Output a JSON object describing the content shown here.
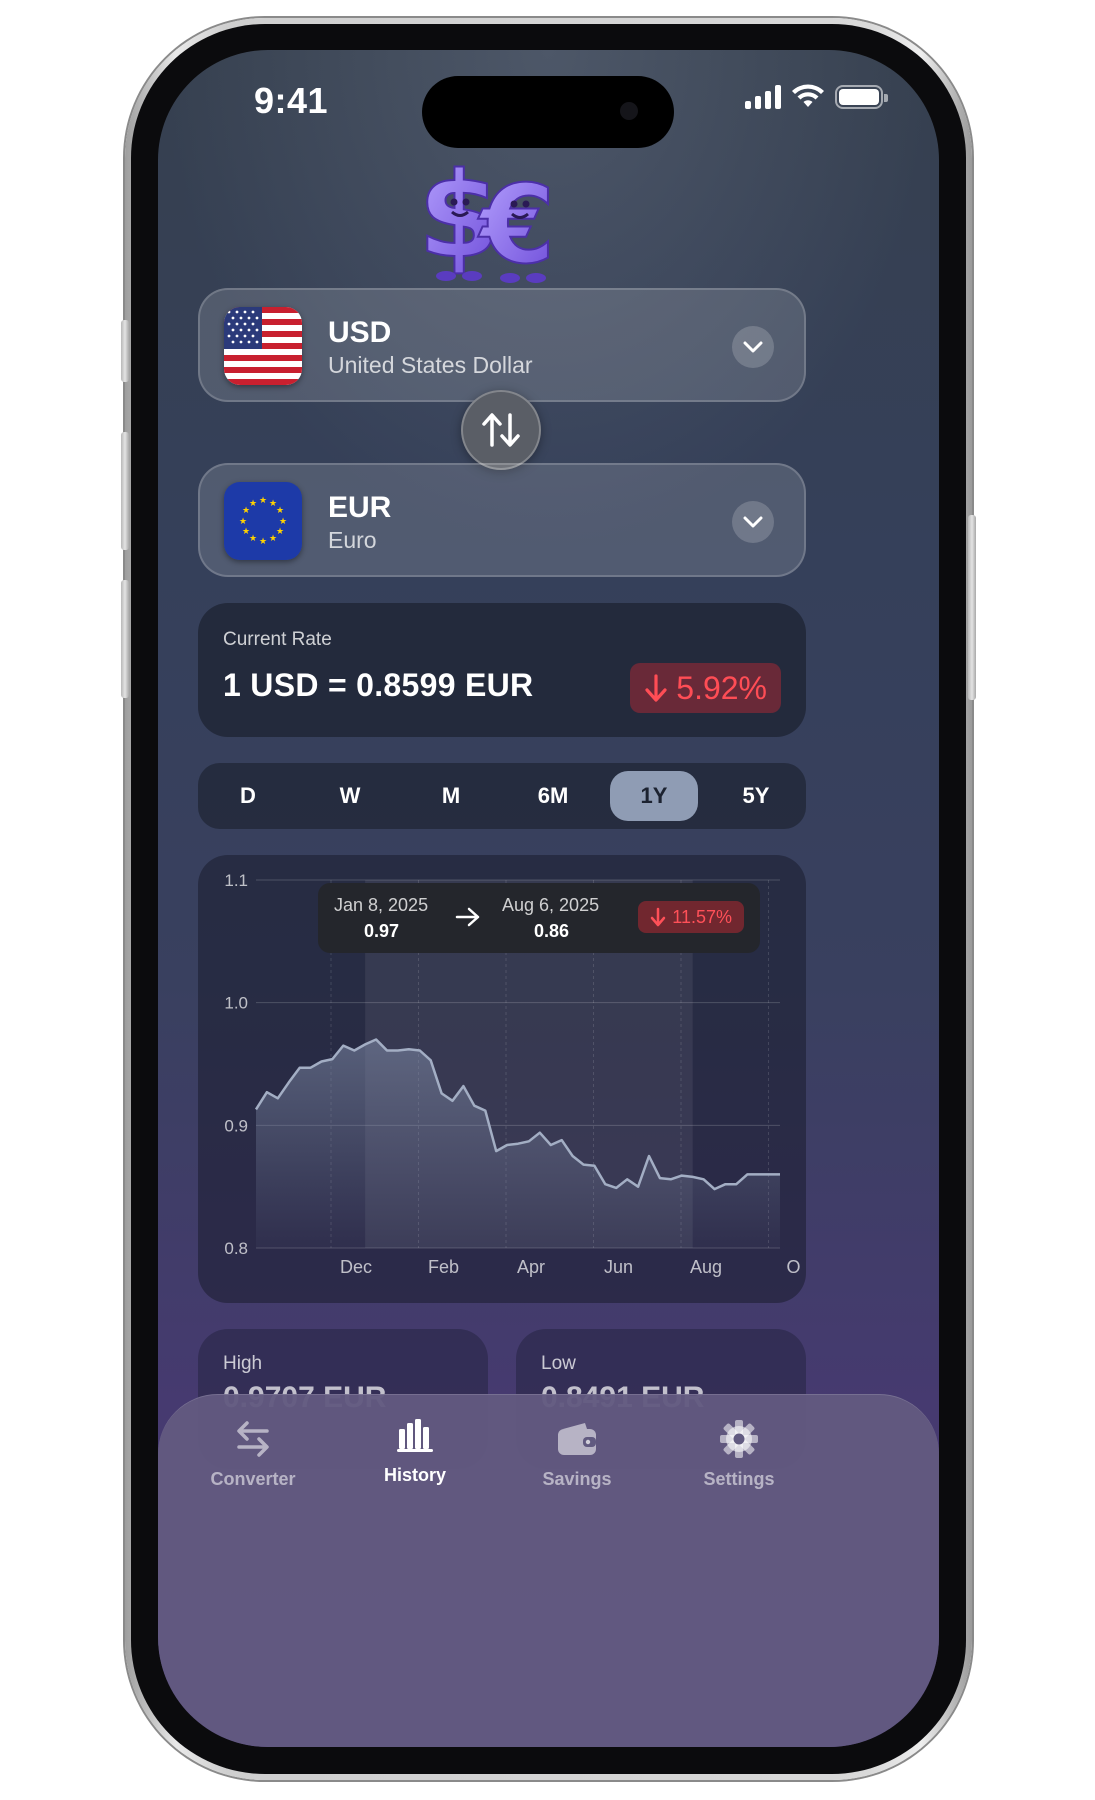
{
  "status_bar": {
    "time": "9:41"
  },
  "from_currency": {
    "code": "USD",
    "name": "United States Dollar",
    "flag": "us-flag"
  },
  "to_currency": {
    "code": "EUR",
    "name": "Euro",
    "flag": "eu-flag"
  },
  "swap_icon": "swap-vertical-icon",
  "current_rate": {
    "label": "Current Rate",
    "value": "1 USD = 0.8599 EUR",
    "change": "5.92%",
    "change_direction": "down",
    "change_color": "#ff4d55"
  },
  "periods": [
    {
      "label": "D",
      "active": false
    },
    {
      "label": "W",
      "active": false
    },
    {
      "label": "M",
      "active": false
    },
    {
      "label": "6M",
      "active": false
    },
    {
      "label": "1Y",
      "active": true
    },
    {
      "label": "5Y",
      "active": false
    }
  ],
  "chart_data": {
    "type": "area",
    "title": "",
    "xlabel": "",
    "ylabel": "",
    "ylim": [
      0.8,
      1.1
    ],
    "yticks": [
      "1.1",
      "1.0",
      "0.9",
      "0.8"
    ],
    "xticks": [
      "Dec",
      "Feb",
      "Apr",
      "Jun",
      "Aug",
      "O"
    ],
    "grid": true,
    "line_color": "#a3aec4",
    "series": [
      {
        "x": [
          "Nov 1",
          "Nov 8",
          "Nov 15",
          "Nov 22",
          "Nov 29",
          "Dec 6",
          "Dec 13",
          "Dec 20",
          "Dec 27",
          "Jan 3",
          "Jan 10",
          "Jan 17",
          "Jan 24",
          "Jan 31",
          "Feb 7",
          "Feb 14",
          "Feb 21",
          "Feb 28",
          "Mar 7",
          "Mar 14",
          "Mar 21",
          "Mar 28",
          "Apr 4",
          "Apr 11",
          "Apr 18",
          "Apr 25",
          "May 2",
          "May 9",
          "May 16",
          "May 23",
          "May 30",
          "Jun 6",
          "Jun 13",
          "Jun 20",
          "Jun 27",
          "Jul 4",
          "Jul 11",
          "Jul 18",
          "Jul 25",
          "Aug 1",
          "Aug 8",
          "Aug 15",
          "Aug 22",
          "Aug 29",
          "Sep 5",
          "Sep 12",
          "Sep 19",
          "Sep 26",
          "Oct 3"
        ],
        "values": [
          0.913,
          0.927,
          0.922,
          0.935,
          0.947,
          0.947,
          0.952,
          0.954,
          0.965,
          0.961,
          0.966,
          0.97,
          0.961,
          0.961,
          0.962,
          0.961,
          0.953,
          0.926,
          0.92,
          0.932,
          0.916,
          0.912,
          0.879,
          0.884,
          0.885,
          0.887,
          0.894,
          0.884,
          0.888,
          0.875,
          0.868,
          0.867,
          0.852,
          0.849,
          0.856,
          0.85,
          0.875,
          0.857,
          0.856,
          0.859,
          0.858,
          0.856,
          0.848,
          0.852,
          0.852,
          0.86,
          0.86,
          0.86,
          0.86
        ]
      }
    ],
    "selection": {
      "start_date": "Jan 8, 2025",
      "start_value": "0.97",
      "end_date": "Aug 6, 2025",
      "end_value": "0.86",
      "change": "11.57%",
      "change_direction": "down"
    }
  },
  "stats": {
    "high_label": "High",
    "high_value": "0.9707 EUR",
    "low_label": "Low",
    "low_value": "0.8491 EUR"
  },
  "nav": [
    {
      "label": "Converter",
      "icon": "arrows-left-right-icon",
      "active": false
    },
    {
      "label": "History",
      "icon": "bar-chart-icon",
      "active": true
    },
    {
      "label": "Savings",
      "icon": "wallet-icon",
      "active": false
    },
    {
      "label": "Settings",
      "icon": "gear-icon",
      "active": false
    }
  ]
}
